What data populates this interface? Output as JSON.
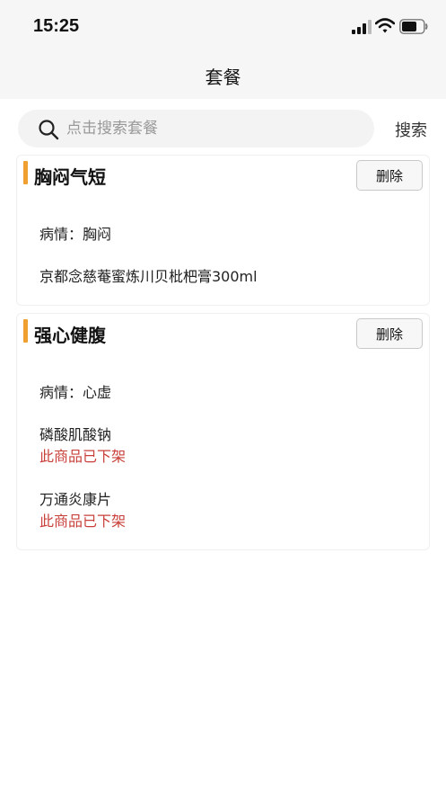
{
  "status_bar": {
    "time": "15:25",
    "icons": [
      "signal-icon",
      "wifi-icon",
      "battery-icon"
    ]
  },
  "nav": {
    "title": "套餐"
  },
  "search": {
    "placeholder": "点击搜索套餐",
    "value": "",
    "button_label": "搜索",
    "icon": "search-icon"
  },
  "colors": {
    "accent": "#f0a030",
    "warning": "#c8403a",
    "header_bg": "#f6f6f6"
  },
  "packages": [
    {
      "title": "胸闷气短",
      "delete_label": "删除",
      "condition": "病情：胸闷",
      "items": [
        {
          "name": "京都念慈菴蜜炼川贝枇杷膏300ml",
          "status": ""
        }
      ]
    },
    {
      "title": "强心健腹",
      "delete_label": "删除",
      "condition": "病情：心虚",
      "items": [
        {
          "name": "磷酸肌酸钠",
          "status": "此商品已下架"
        },
        {
          "name": "万通炎康片",
          "status": "此商品已下架"
        }
      ]
    }
  ]
}
